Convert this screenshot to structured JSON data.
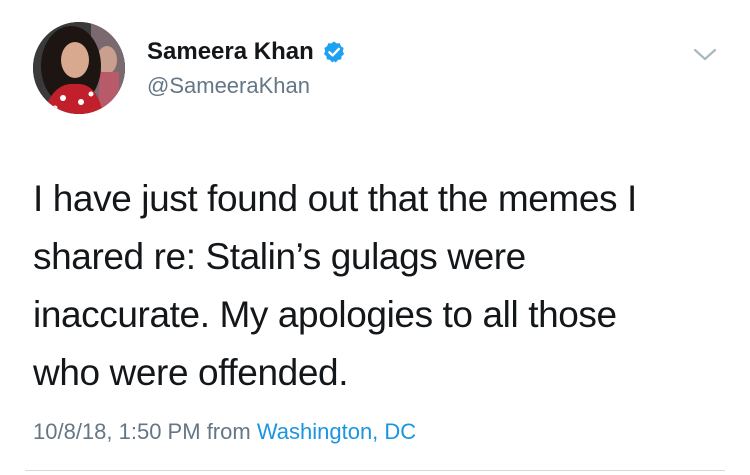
{
  "user": {
    "display_name": "Sameera Khan",
    "handle": "@SameeraKhan",
    "verified": true
  },
  "tweet": {
    "lines": [
      "I have just found out that the memes I",
      "shared re: Stalin’s gulags were",
      "inaccurate. My apologies to all those",
      "who were offended."
    ],
    "timestamp": "10/8/18, 1:50 PM",
    "from_label": "from",
    "location": "Washington, DC"
  },
  "colors": {
    "text": "#14171a",
    "secondary": "#657786",
    "link": "#1b95e0",
    "verified_badge": "#1da1f2"
  },
  "icons": {
    "verified": "verified-badge-icon",
    "menu": "chevron-down-icon"
  }
}
